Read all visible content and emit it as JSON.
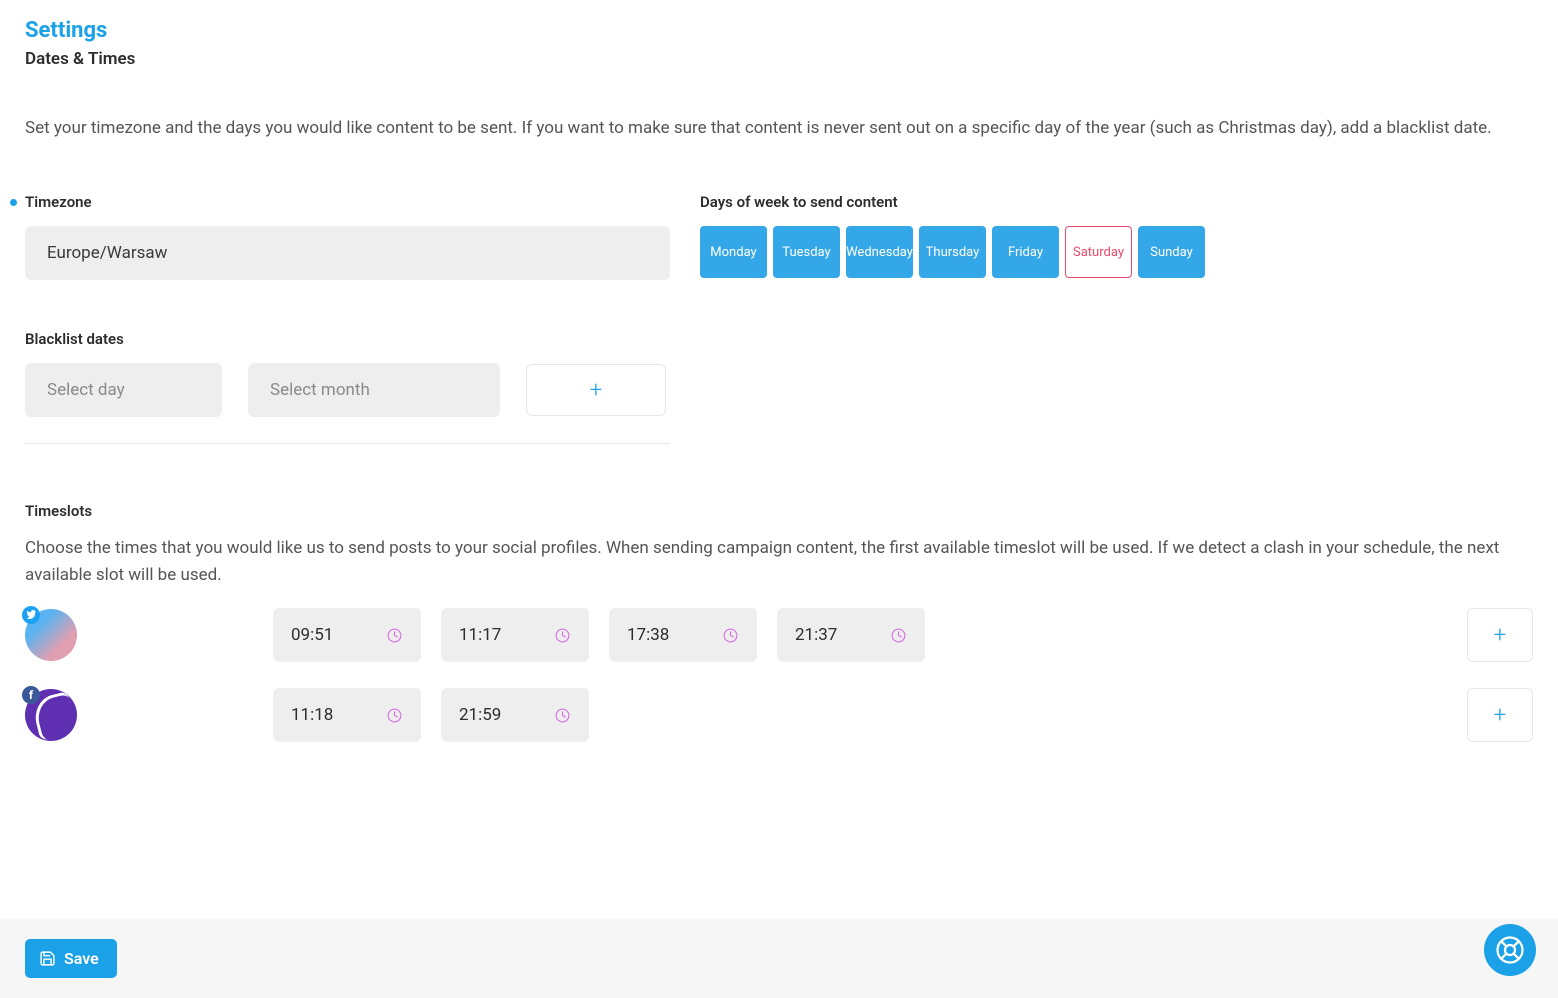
{
  "header": {
    "title": "Settings",
    "subtitle": "Dates & Times"
  },
  "intro": "Set your timezone and the days you would like content to be sent. If you want to make sure that content is never sent out on a specific day of the year (such as Christmas day), add a blacklist date.",
  "timezone": {
    "label": "Timezone",
    "value": "Europe/Warsaw"
  },
  "days": {
    "label": "Days of week to send content",
    "items": [
      {
        "label": "Monday",
        "active": true
      },
      {
        "label": "Tuesday",
        "active": true
      },
      {
        "label": "Wednesday",
        "active": true
      },
      {
        "label": "Thursday",
        "active": true
      },
      {
        "label": "Friday",
        "active": true
      },
      {
        "label": "Saturday",
        "active": false
      },
      {
        "label": "Sunday",
        "active": true
      }
    ]
  },
  "blacklist": {
    "label": "Blacklist dates",
    "day_placeholder": "Select day",
    "month_placeholder": "Select month",
    "add_label": "+"
  },
  "timeslots": {
    "label": "Timeslots",
    "desc": "Choose the times that you would like us to send posts to your social profiles. When sending campaign content, the first available timeslot will be used. If we detect a clash in your schedule, the next available slot will be used.",
    "profiles": [
      {
        "network": "twitter",
        "slots": [
          "09:51",
          "11:17",
          "17:38",
          "21:37"
        ]
      },
      {
        "network": "facebook",
        "slots": [
          "11:18",
          "21:59"
        ]
      }
    ],
    "add_label": "+"
  },
  "footer": {
    "save_label": "Save"
  }
}
